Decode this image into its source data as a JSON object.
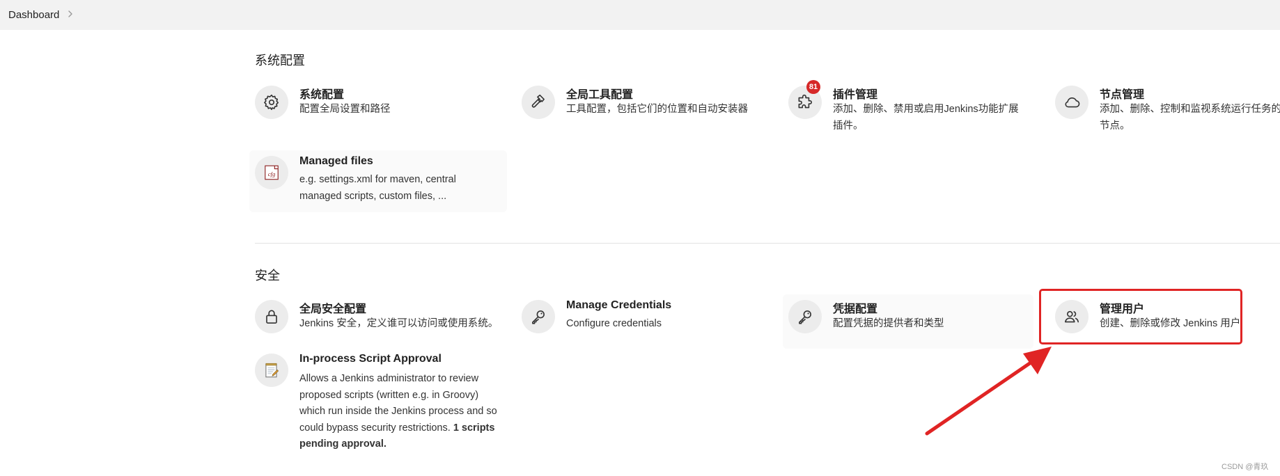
{
  "breadcrumb": {
    "dashboard": "Dashboard",
    "separator_icon": "chevron-right-icon"
  },
  "sections": {
    "system": {
      "title": "系统配置",
      "items": [
        {
          "title": "系统配置",
          "desc": "配置全局设置和路径",
          "icon": "gear-icon"
        },
        {
          "title": "全局工具配置",
          "desc": "工具配置，包括它们的位置和自动安装器",
          "icon": "hammer-icon"
        },
        {
          "title": "插件管理",
          "desc": "添加、删除、禁用或启用Jenkins功能扩展插件。",
          "icon": "puzzle-icon",
          "badge": "81"
        },
        {
          "title": "节点管理",
          "desc": "添加、删除、控制和监视系统运行任务的节点。",
          "icon": "cloud-icon"
        },
        {
          "title": "Managed files",
          "desc": "e.g. settings.xml for maven, central managed scripts, custom files, ...",
          "icon": "cfg-file-icon"
        }
      ]
    },
    "security": {
      "title": "安全",
      "items": [
        {
          "title": "全局安全配置",
          "desc": "Jenkins 安全，定义谁可以访问或使用系统。",
          "icon": "lock-icon"
        },
        {
          "title": "Manage Credentials",
          "desc": "Configure credentials",
          "icon": "key-icon"
        },
        {
          "title": "凭据配置",
          "desc": "配置凭据的提供者和类型",
          "icon": "key-icon"
        },
        {
          "title": "管理用户",
          "desc": "创建、删除或修改 Jenkins 用户",
          "icon": "users-icon"
        },
        {
          "title": "In-process Script Approval",
          "desc": "Allows a Jenkins administrator to review proposed scripts (written e.g. in Groovy) which run inside the Jenkins process and so could bypass security restrictions.",
          "desc_strong": "1 scripts pending approval.",
          "icon": "notepad-icon"
        }
      ]
    }
  },
  "annotation": {
    "box_color": "#e02424",
    "arrow_color": "#e02424"
  },
  "watermark": "CSDN @青玖"
}
